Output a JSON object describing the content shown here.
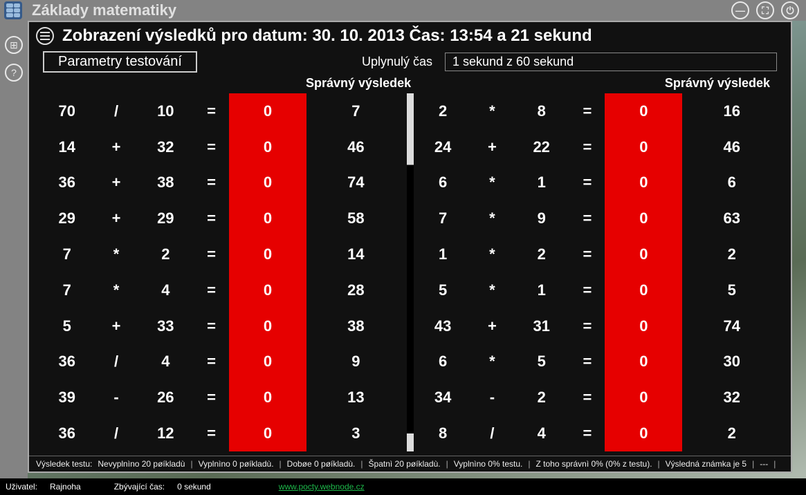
{
  "app": {
    "title": "Základy matematiky"
  },
  "panel": {
    "title": "Zobrazení výsledků pro datum: 30. 10. 2013 Čas: 13:54 a 21 sekund",
    "params_button": "Parametry testování",
    "elapsed_label": "Uplynulý čas",
    "elapsed_value": "1 sekund z 60 sekund",
    "correct_header_left": "Správný výsledek",
    "correct_header_right": "Správný výsledek"
  },
  "left_rows": [
    {
      "a": "70",
      "op": "/",
      "b": "10",
      "eq": "=",
      "ans": "0",
      "correct": "7"
    },
    {
      "a": "14",
      "op": "+",
      "b": "32",
      "eq": "=",
      "ans": "0",
      "correct": "46"
    },
    {
      "a": "36",
      "op": "+",
      "b": "38",
      "eq": "=",
      "ans": "0",
      "correct": "74"
    },
    {
      "a": "29",
      "op": "+",
      "b": "29",
      "eq": "=",
      "ans": "0",
      "correct": "58"
    },
    {
      "a": "7",
      "op": "*",
      "b": "2",
      "eq": "=",
      "ans": "0",
      "correct": "14"
    },
    {
      "a": "7",
      "op": "*",
      "b": "4",
      "eq": "=",
      "ans": "0",
      "correct": "28"
    },
    {
      "a": "5",
      "op": "+",
      "b": "33",
      "eq": "=",
      "ans": "0",
      "correct": "38"
    },
    {
      "a": "36",
      "op": "/",
      "b": "4",
      "eq": "=",
      "ans": "0",
      "correct": "9"
    },
    {
      "a": "39",
      "op": "-",
      "b": "26",
      "eq": "=",
      "ans": "0",
      "correct": "13"
    },
    {
      "a": "36",
      "op": "/",
      "b": "12",
      "eq": "=",
      "ans": "0",
      "correct": "3"
    }
  ],
  "right_rows": [
    {
      "a": "2",
      "op": "*",
      "b": "8",
      "eq": "=",
      "ans": "0",
      "correct": "16"
    },
    {
      "a": "24",
      "op": "+",
      "b": "22",
      "eq": "=",
      "ans": "0",
      "correct": "46"
    },
    {
      "a": "6",
      "op": "*",
      "b": "1",
      "eq": "=",
      "ans": "0",
      "correct": "6"
    },
    {
      "a": "7",
      "op": "*",
      "b": "9",
      "eq": "=",
      "ans": "0",
      "correct": "63"
    },
    {
      "a": "1",
      "op": "*",
      "b": "2",
      "eq": "=",
      "ans": "0",
      "correct": "2"
    },
    {
      "a": "5",
      "op": "*",
      "b": "1",
      "eq": "=",
      "ans": "0",
      "correct": "5"
    },
    {
      "a": "43",
      "op": "+",
      "b": "31",
      "eq": "=",
      "ans": "0",
      "correct": "74"
    },
    {
      "a": "6",
      "op": "*",
      "b": "5",
      "eq": "=",
      "ans": "0",
      "correct": "30"
    },
    {
      "a": "34",
      "op": "-",
      "b": "2",
      "eq": "=",
      "ans": "0",
      "correct": "32"
    },
    {
      "a": "8",
      "op": "/",
      "b": "4",
      "eq": "=",
      "ans": "0",
      "correct": "2"
    }
  ],
  "summary": {
    "label": "Výsledek testu:",
    "s1": "Nevyplnìno 20 pøíkladù",
    "s2": "Vyplnìno 0 pøíkladù.",
    "s3": "Dobøe 0 pøíkladù.",
    "s4": "Špatnì 20 pøíkladù.",
    "s5": "Vyplnìno 0% testu.",
    "s6": "Z toho správnì 0% (0% z testu).",
    "s7": "Výsledná známka je 5",
    "s8": "---"
  },
  "footer": {
    "user_label": "Uživatel:",
    "user_name": "Rajnoha",
    "remaining_label": "Zbývající čas:",
    "remaining_value": "0 sekund",
    "link": "www.pocty.webnode.cz"
  }
}
